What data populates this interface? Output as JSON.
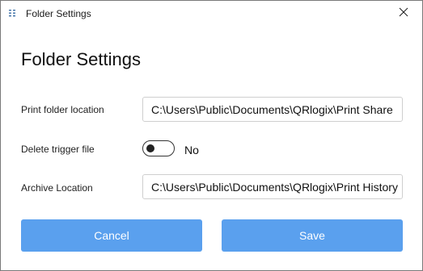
{
  "window": {
    "title": "Folder Settings"
  },
  "icons": {
    "app": "folder-settings-app-icon",
    "close": "close-icon"
  },
  "page": {
    "heading": "Folder Settings"
  },
  "form": {
    "print_folder": {
      "label": "Print folder location",
      "value": "C:\\Users\\Public\\Documents\\QRlogix\\Print Share"
    },
    "delete_trigger": {
      "label": "Delete trigger file",
      "checked": false,
      "state_text": "No"
    },
    "archive": {
      "label": "Archive Location",
      "value": "C:\\Users\\Public\\Documents\\QRlogix\\Print History"
    }
  },
  "actions": {
    "cancel_label": "Cancel",
    "save_label": "Save"
  },
  "colors": {
    "button_bg": "#5aa0ee",
    "button_text": "#ffffff"
  }
}
